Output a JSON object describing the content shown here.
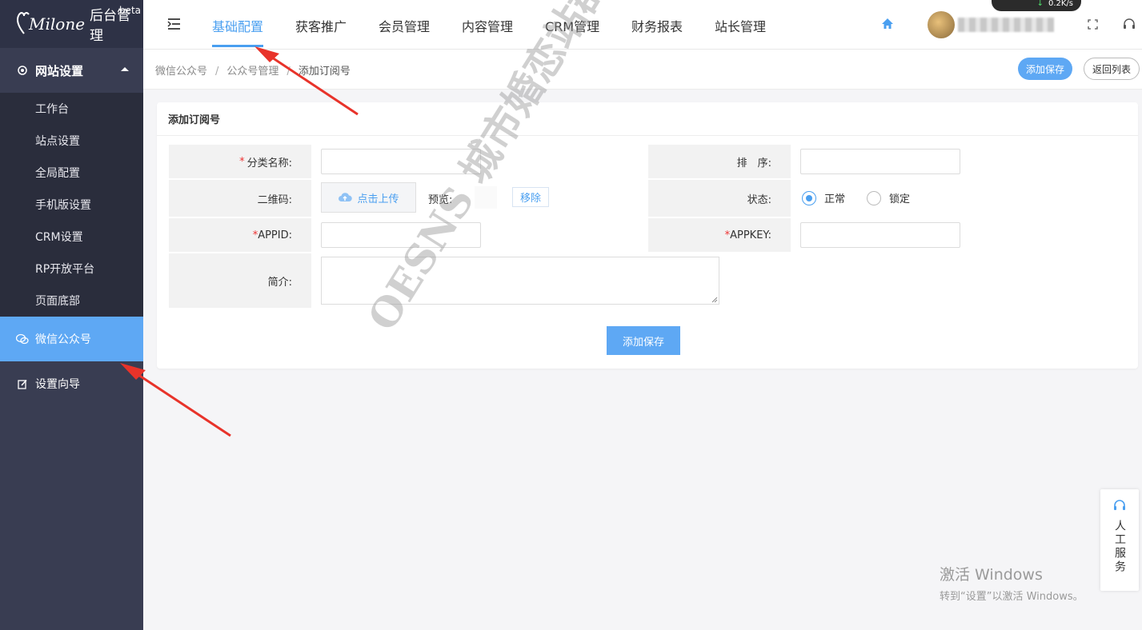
{
  "logo": {
    "script": "Milone",
    "text": "后台管理",
    "badge": "beta"
  },
  "sidebar": {
    "group": {
      "label": "网站设置",
      "icon": "gear-icon"
    },
    "sub_items": [
      "工作台",
      "站点设置",
      "全局配置",
      "手机版设置",
      "CRM设置",
      "RP开放平台",
      "页面底部"
    ],
    "items": [
      {
        "label": "微信公众号",
        "icon": "wechat-icon",
        "active": true
      },
      {
        "label": "设置向导",
        "icon": "edit-icon",
        "active": false
      }
    ]
  },
  "topnav": {
    "items": [
      "基础配置",
      "获客推广",
      "会员管理",
      "内容管理",
      "CRM管理",
      "财务报表",
      "站长管理"
    ],
    "active_index": 0,
    "speed": "0.2K/s"
  },
  "breadcrumb": {
    "items": [
      "微信公众号",
      "公众号管理",
      "添加订阅号"
    ],
    "separator": "/"
  },
  "actions": {
    "save": "添加保存",
    "back": "返回列表"
  },
  "form": {
    "title": "添加订阅号",
    "category_label": "分类名称:",
    "sort_label": "排　序:",
    "qrcode_label": "二维码:",
    "upload_label": "点击上传",
    "preview_label": "预览:",
    "remove_label": "移除",
    "status_label": "状态:",
    "status_options": [
      "正常",
      "锁定"
    ],
    "status_selected": "正常",
    "appid_label": "APPID:",
    "appkey_label": "APPKEY:",
    "intro_label": "简介:",
    "submit_label": "添加保存",
    "required_mark": "*"
  },
  "watermark": "OESNS 城市婚恋站群系统",
  "service": {
    "label": "人工服务"
  },
  "windows": {
    "title": "激活 Windows",
    "subtitle": "转到“设置”以激活 Windows。"
  },
  "colors": {
    "accent": "#5ea8f4",
    "sidebar": "#393d52",
    "sidebar_sub": "#2a2d3c",
    "arrow": "#e8332a"
  }
}
